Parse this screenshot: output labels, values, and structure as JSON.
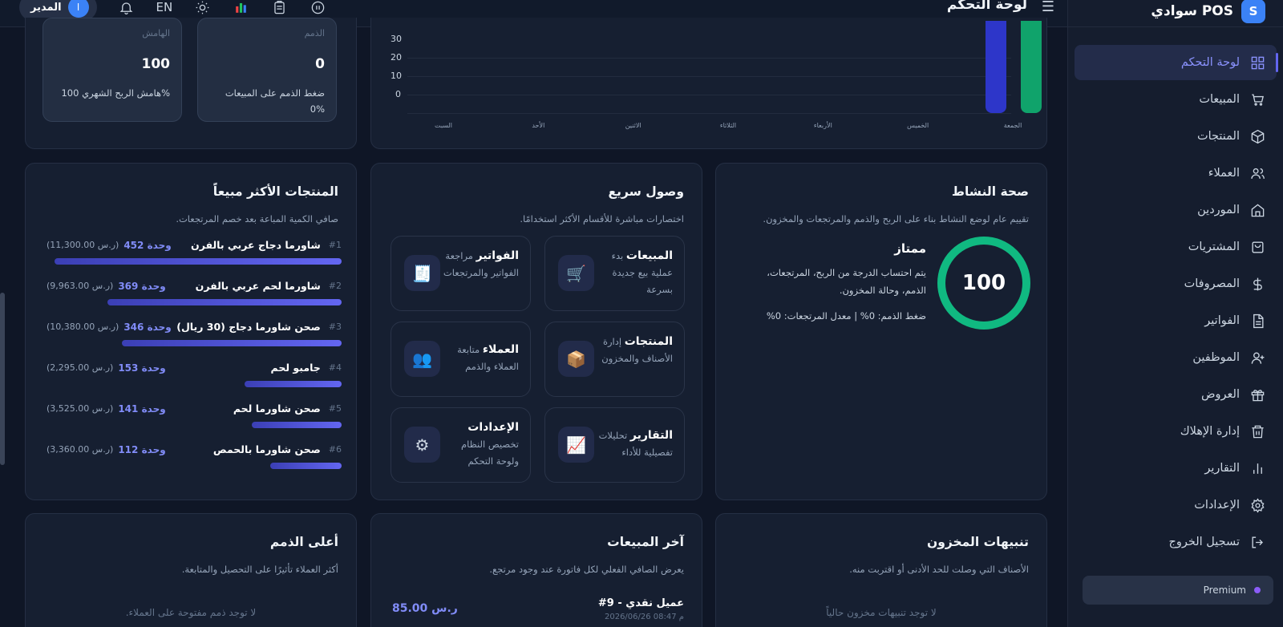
{
  "brand": {
    "logo_letter": "S",
    "name": "سوادي POS"
  },
  "sidebar": {
    "items": [
      {
        "label": "لوحة التحكم",
        "icon": "grid-icon",
        "active": true
      },
      {
        "label": "المبيعات",
        "icon": "cart-icon"
      },
      {
        "label": "المنتجات",
        "icon": "box-icon"
      },
      {
        "label": "العملاء",
        "icon": "users-icon"
      },
      {
        "label": "الموردين",
        "icon": "home-icon"
      },
      {
        "label": "المشتريات",
        "icon": "bag-icon"
      },
      {
        "label": "المصروفات",
        "icon": "dollar-icon"
      },
      {
        "label": "الفواتير",
        "icon": "document-icon"
      },
      {
        "label": "الموظفين",
        "icon": "user-plus-icon"
      },
      {
        "label": "العروض",
        "icon": "gift-icon"
      },
      {
        "label": "إدارة الإهلاك",
        "icon": "trash-icon"
      },
      {
        "label": "التقارير",
        "icon": "bar-chart-icon"
      },
      {
        "label": "الإعدادات",
        "icon": "gear-icon"
      },
      {
        "label": "تسجيل الخروج",
        "icon": "logout-icon"
      }
    ],
    "premium_label": "Premium"
  },
  "topbar": {
    "title": "لوحة التحكم",
    "user_name": "المدير",
    "user_initial": "ا",
    "lang": "EN"
  },
  "stats": {
    "receivables": {
      "label": "الذمم",
      "value": "0",
      "desc": "ضغط الذمم على المبيعات",
      "desc2": "0%"
    },
    "margin": {
      "label": "الهامش",
      "value": "100",
      "desc": "هامش الربح الشهري 100%"
    }
  },
  "chart_data": {
    "type": "bar",
    "categories": [
      "السبت",
      "الأحد",
      "الاثنين",
      "الثلاثاء",
      "الأربعاء",
      "الخميس",
      "الجمعة"
    ],
    "series": [
      {
        "values": [
          0,
          0,
          0,
          0,
          0,
          0,
          38
        ],
        "color": "#2d36c9"
      },
      {
        "values": [
          0,
          0,
          0,
          0,
          0,
          0,
          38
        ],
        "color": "#10a36b"
      }
    ],
    "yticks": [
      "30",
      "20",
      "10",
      "0"
    ],
    "ylim": [
      0,
      38
    ]
  },
  "health": {
    "title": "صحة النشاط",
    "subtitle": "تقييم عام لوضع النشاط بناء على الربح والذمم والمرتجعات والمخزون.",
    "score": "100",
    "score_progress": 1.0,
    "rating": "ممتاز",
    "desc": "يتم احتساب الدرجة من الربح، المرتجعات، الذمم، وحالة المخزون.",
    "stats_line": "ضغط الذمم: 0% | معدل المرتجعات: 0%"
  },
  "quick": {
    "title": "وصول سريع",
    "subtitle": "اختصارات مباشرة للأقسام الأكثر استخدامًا.",
    "items": [
      {
        "title": "المبيعات",
        "desc": "بدء عملية بيع جديدة بسرعة",
        "icon": "🛒"
      },
      {
        "title": "الفواتير",
        "desc": "مراجعة الفواتير والمرتجعات",
        "icon": "🧾"
      },
      {
        "title": "المنتجات",
        "desc": "إدارة الأصناف والمخزون",
        "icon": "📦"
      },
      {
        "title": "العملاء",
        "desc": "متابعة العملاء والذمم",
        "icon": "👥"
      },
      {
        "title": "التقارير",
        "desc": "تحليلات تفصيلية للأداء",
        "icon": "📈"
      },
      {
        "title": "الإعدادات",
        "desc": "تخصيص النظام ولوحة التحكم",
        "icon": "⚙"
      }
    ]
  },
  "best_sellers": {
    "title": "المنتجات الأكثر مبيعاً",
    "subtitle": "صافي الكمية المباعة بعد خصم المرتجعات.",
    "items": [
      {
        "idx": "#1",
        "name": "شاورما دجاج عربي بالفرن",
        "units": "452 وحدة",
        "amount": "(11,300.00 ر.س)",
        "ratio": 1.0
      },
      {
        "idx": "#2",
        "name": "شاورما لحم عربي بالفرن",
        "units": "369 وحدة",
        "amount": "(9,963.00 ر.س)",
        "ratio": 0.816
      },
      {
        "idx": "#3",
        "name": "صحن شاورما دجاج (30 ريال)",
        "units": "346 وحدة",
        "amount": "(10,380.00 ر.س)",
        "ratio": 0.765
      },
      {
        "idx": "#4",
        "name": "جامبو لحم",
        "units": "153 وحدة",
        "amount": "(2,295.00 ر.س)",
        "ratio": 0.338
      },
      {
        "idx": "#5",
        "name": "صحن شاورما لحم",
        "units": "141 وحدة",
        "amount": "(3,525.00 ر.س)",
        "ratio": 0.312
      },
      {
        "idx": "#6",
        "name": "صحن شاورما بالحمص",
        "units": "112 وحدة",
        "amount": "(3,360.00 ر.س)",
        "ratio": 0.248
      }
    ]
  },
  "stock_alerts": {
    "title": "تنبيهات المخزون",
    "subtitle": "الأصناف التي وصلت للحد الأدنى أو اقتربت منه.",
    "empty": "لا توجد تنبيهات مخزون حالياً"
  },
  "latest_sales": {
    "title": "آخر المبيعات",
    "subtitle": "يعرض الصافي الفعلي لكل فاتورة عند وجود مرتجع.",
    "rows": [
      {
        "title": "#9 - عميل نقدي",
        "date": "2026/06/26 08:47 م",
        "amount": "85.00 ر.س"
      }
    ]
  },
  "top_debts": {
    "title": "أعلى الذمم",
    "subtitle": "أكثر العملاء تأثيرًا على التحصيل والمتابعة.",
    "empty": "لا توجد ذمم مفتوحة على العملاء."
  }
}
